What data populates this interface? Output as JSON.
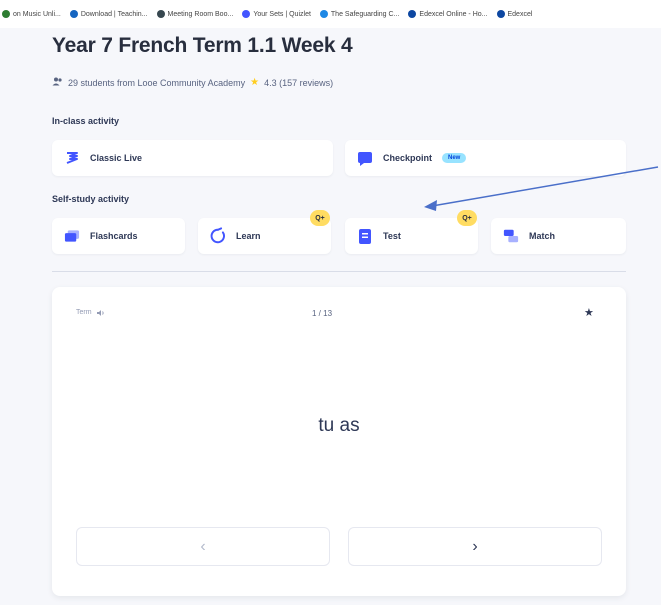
{
  "bookmarks": [
    {
      "label": "on Music Unli...",
      "color": "#2e7d32"
    },
    {
      "label": "Download | Teachin...",
      "color": "#1565c0"
    },
    {
      "label": "Meeting Room Boo...",
      "color": "#37474f"
    },
    {
      "label": "Your Sets | Quizlet",
      "color": "#4255ff"
    },
    {
      "label": "The Safeguarding C...",
      "color": "#1e88e5"
    },
    {
      "label": "Edexcel Online - Ho...",
      "color": "#0d47a1"
    },
    {
      "label": "Edexcel",
      "color": "#0d47a1"
    }
  ],
  "header": {
    "title": "Year 7 French Term 1.1 Week 4",
    "students": "29 students from Looe Community Academy",
    "rating": "4.3 (157 reviews)"
  },
  "in_class": {
    "label": "In-class activity",
    "classic_live": "Classic Live",
    "checkpoint": "Checkpoint",
    "new_badge": "New"
  },
  "self_study": {
    "label": "Self-study activity",
    "flashcards": "Flashcards",
    "learn": "Learn",
    "test": "Test",
    "match": "Match",
    "plus_badge": "Q+"
  },
  "flashcard": {
    "term_label": "Term",
    "counter": "1 / 13",
    "word": "tu as",
    "prev": "‹",
    "next": "›"
  },
  "colors": {
    "accent": "#4255ff",
    "annotation_arrow": "#4a6fc9"
  }
}
